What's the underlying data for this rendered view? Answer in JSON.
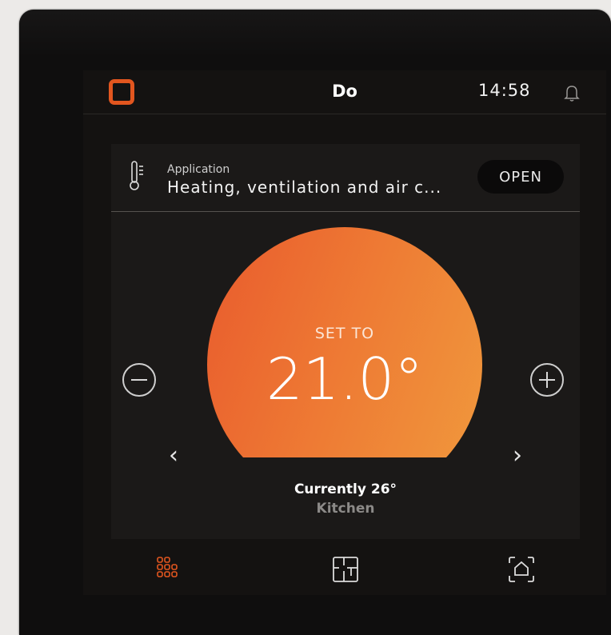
{
  "statusbar": {
    "title": "Do",
    "time": "14:58",
    "logo_icon": "rounded-square-logo",
    "notification_icon": "bell-icon"
  },
  "app": {
    "label": "Application",
    "name": "Heating, ventilation and air c...",
    "open_label": "OPEN",
    "icon": "thermometer-icon"
  },
  "thermostat": {
    "set_label": "SET TO",
    "setpoint": "21.0°",
    "current": "Currently 26°",
    "room": "Kitchen"
  },
  "nav": {
    "items": [
      {
        "icon": "rooms-grid-icon",
        "active": true
      },
      {
        "icon": "floorplan-icon",
        "active": false
      },
      {
        "icon": "home-scan-icon",
        "active": false
      }
    ]
  },
  "colors": {
    "accent": "#e2561f",
    "dial_start": "#e95b2d",
    "dial_end": "#f09a3d",
    "background": "#141211"
  }
}
